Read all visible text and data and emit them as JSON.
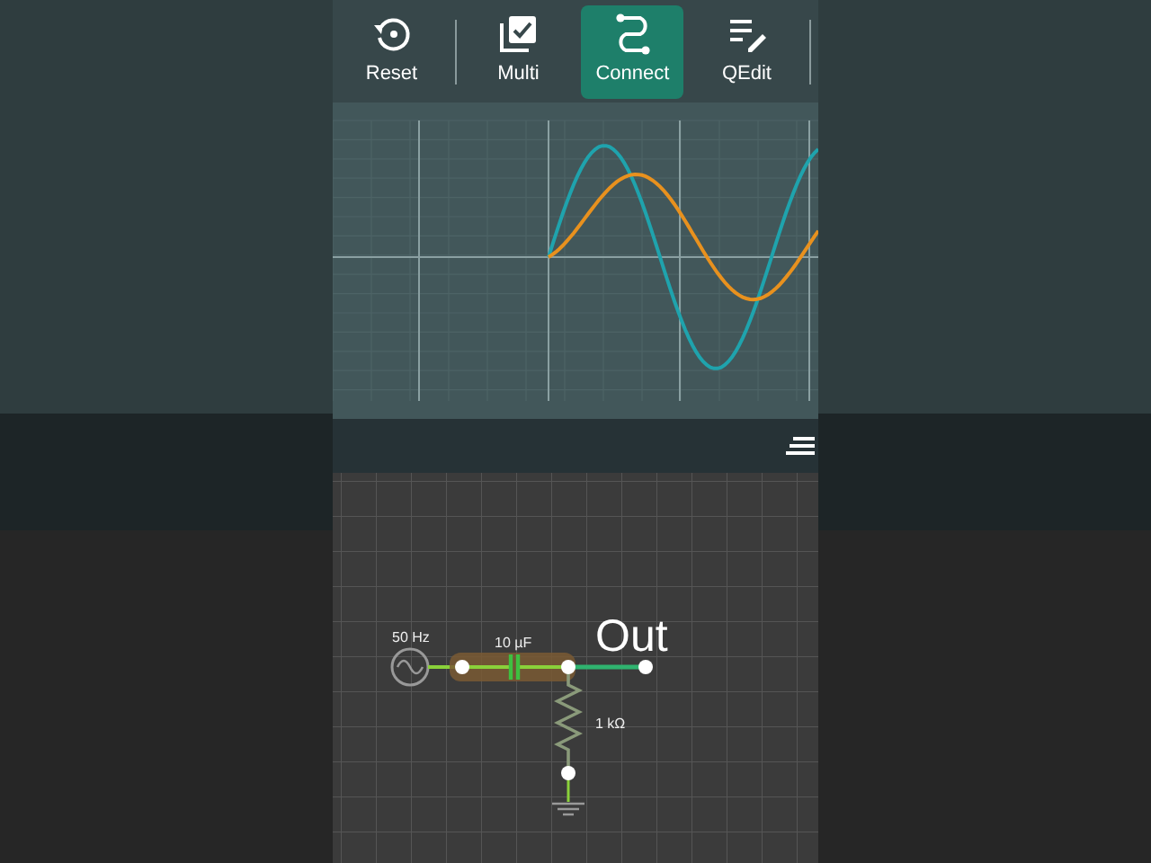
{
  "toolbar": {
    "buttons": [
      {
        "label": "Reset",
        "kind": "reset",
        "selected": false
      },
      {
        "label": "Multi",
        "kind": "multi",
        "selected": false
      },
      {
        "label": "Connect",
        "kind": "connect",
        "selected": true
      },
      {
        "label": "QEdit",
        "kind": "qedit",
        "selected": false
      }
    ]
  },
  "circuit": {
    "source_label": "50 Hz",
    "capacitor_label": "10 µF",
    "output_label": "Out",
    "resistor_label": "1 kΩ"
  }
}
